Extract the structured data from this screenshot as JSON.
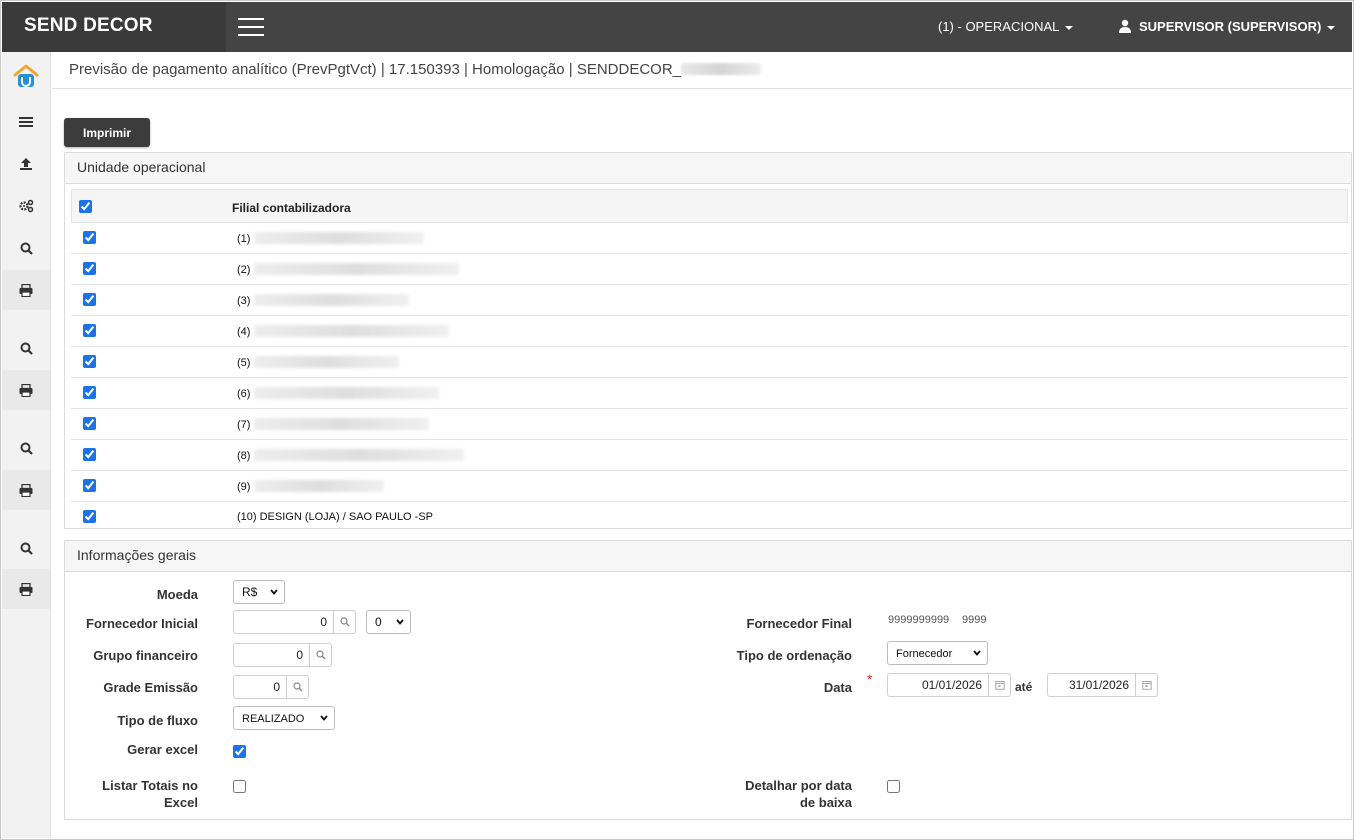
{
  "header": {
    "brand": "SEND DECOR",
    "unit_selector": "(1) - OPERACIONAL",
    "user_menu": "SUPERVISOR (SUPERVISOR)"
  },
  "sidebar": {
    "items": [
      "home-icon",
      "list-icon",
      "upload-icon",
      "gears-icon",
      "search-icon",
      "print-icon",
      "search-icon",
      "print-icon",
      "search-icon",
      "print-icon",
      "search-icon",
      "print-icon"
    ]
  },
  "breadcrumb": "Previsão de pagamento analítico (PrevPgtVct) | 17.150393 | Homologação | SENDDECOR_",
  "print_button": "Imprimir",
  "unidade": {
    "title": "Unidade operacional",
    "column_header": "Filial contabilizadora",
    "rows": [
      "(1)",
      "(2)",
      "(3)",
      "(4)",
      "(5)",
      "(6)",
      "(7)",
      "(8)",
      "(9)",
      "(10) DESIGN (LOJA) / SAO PAULO -SP"
    ]
  },
  "info": {
    "title": "Informações gerais",
    "moeda_label": "Moeda",
    "moeda_value": "R$",
    "fornecedor_inicial_label": "Fornecedor Inicial",
    "fornecedor_inicial_value": "0",
    "fornecedor_inicial_sel": "0",
    "fornecedor_final_label": "Fornecedor Final",
    "fornecedor_final_value": "9999999999",
    "fornecedor_final_sub": "9999",
    "grupo_label": "Grupo financeiro",
    "grupo_value": "0",
    "ordenacao_label": "Tipo de ordenação",
    "ordenacao_value": "Fornecedor",
    "grade_label": "Grade Emissão",
    "grade_value": "0",
    "data_label": "Data",
    "data_required": "*",
    "data_inicio": "01/01/2026",
    "data_ate": "até",
    "data_fim": "31/01/2026",
    "fluxo_label": "Tipo de fluxo",
    "fluxo_value": "REALIZADO",
    "excel_label": "Gerar excel",
    "totais_label_1": "Listar Totais no",
    "totais_label_2": "Excel",
    "detalhar_label_1": "Detalhar por data",
    "detalhar_label_2": "de baixa"
  },
  "colors": {
    "topbar": "#444444",
    "brand_bg": "#3a3a3a",
    "accent": "#1a73e8",
    "button": "#3c3c3c"
  }
}
